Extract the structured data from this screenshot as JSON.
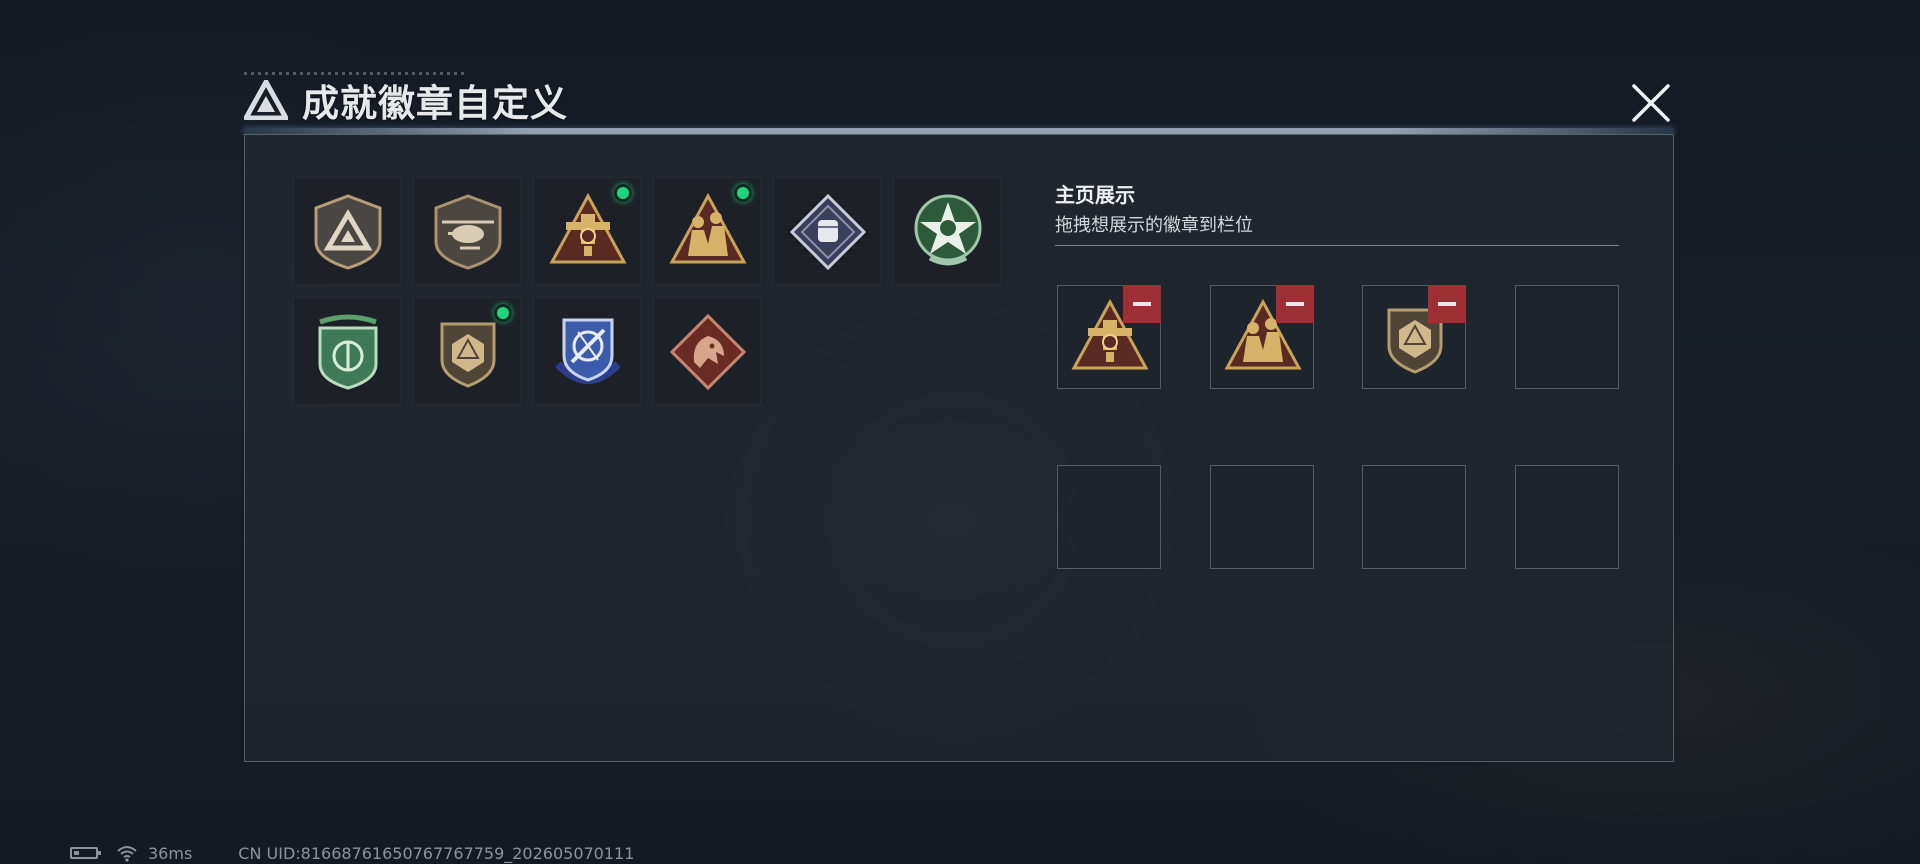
{
  "header": {
    "title": "成就徽章自定义"
  },
  "badges": [
    {
      "icon": "triangle-logo-shield-badge",
      "new": false
    },
    {
      "icon": "helicopter-shield-badge",
      "new": false
    },
    {
      "icon": "gold-tower-triangle-badge",
      "new": true
    },
    {
      "icon": "gold-soldiers-triangle-badge",
      "new": true
    },
    {
      "icon": "silver-fist-diamond-badge",
      "new": false
    },
    {
      "icon": "green-star-emblem-badge",
      "new": false
    },
    {
      "icon": "green-wreath-shield-badge",
      "new": false
    },
    {
      "icon": "bronze-d20-shield-badge",
      "new": true
    },
    {
      "icon": "blue-crossed-blades-shield-badge",
      "new": false
    },
    {
      "icon": "red-dragon-diamond-badge",
      "new": false
    }
  ],
  "showcase": {
    "title": "主页展示",
    "subtitle": "拖拽想展示的徽章到栏位",
    "slots": [
      {
        "icon": "gold-tower-triangle-badge",
        "filled": true
      },
      {
        "icon": "gold-soldiers-triangle-badge",
        "filled": true
      },
      {
        "icon": "bronze-d20-shield-badge",
        "filled": true
      },
      {
        "icon": "",
        "filled": false
      },
      {
        "icon": "",
        "filled": false
      },
      {
        "icon": "",
        "filled": false
      },
      {
        "icon": "",
        "filled": false
      },
      {
        "icon": "",
        "filled": false
      }
    ]
  },
  "status": {
    "ping": "36ms",
    "uid": "CN UID:816687616507677677​59_202605070111"
  },
  "colors": {
    "accent_new_dot": "#22d37e",
    "remove_button": "#9e2f35",
    "gold": "#c9a35a",
    "panel_bg": "#222830"
  }
}
